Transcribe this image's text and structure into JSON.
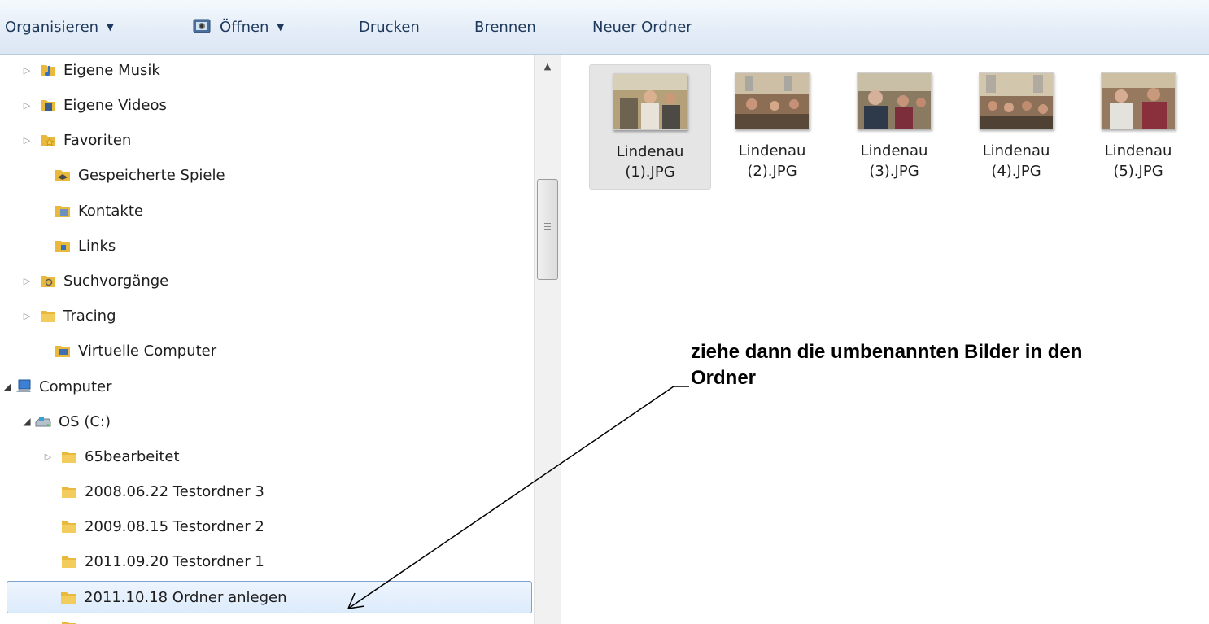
{
  "toolbar": {
    "organize": "Organisieren",
    "open": "Öffnen",
    "print": "Drucken",
    "burn": "Brennen",
    "new_folder": "Neuer Ordner"
  },
  "nav": {
    "items": [
      {
        "label": "Eigene Musik",
        "icon": "music-folder-icon",
        "expander": "collapsed"
      },
      {
        "label": "Eigene Videos",
        "icon": "video-folder-icon",
        "expander": "collapsed"
      },
      {
        "label": "Favoriten",
        "icon": "favorites-folder-icon",
        "expander": "collapsed"
      },
      {
        "label": "Gespeicherte Spiele",
        "icon": "saved-games-folder-icon",
        "expander": "none"
      },
      {
        "label": "Kontakte",
        "icon": "contacts-folder-icon",
        "expander": "none"
      },
      {
        "label": "Links",
        "icon": "links-folder-icon",
        "expander": "none"
      },
      {
        "label": "Suchvorgänge",
        "icon": "searches-folder-icon",
        "expander": "collapsed"
      },
      {
        "label": "Tracing",
        "icon": "folder-icon",
        "expander": "collapsed"
      },
      {
        "label": "Virtuelle Computer",
        "icon": "virtual-machines-folder-icon",
        "expander": "none"
      },
      {
        "label": "Computer",
        "icon": "computer-icon",
        "expander": "expanded"
      },
      {
        "label": "OS (C:)",
        "icon": "drive-icon",
        "expander": "expanded"
      },
      {
        "label": "65bearbeitet",
        "icon": "folder-icon",
        "expander": "collapsed"
      },
      {
        "label": "2008.06.22 Testordner 3",
        "icon": "folder-icon",
        "expander": "none"
      },
      {
        "label": "2009.08.15 Testordner 2",
        "icon": "folder-icon",
        "expander": "none"
      },
      {
        "label": "2011.09.20 Testordner 1",
        "icon": "folder-icon",
        "expander": "none"
      },
      {
        "label": "2011.10.18 Ordner anlegen",
        "icon": "folder-icon",
        "expander": "none",
        "selected": true
      }
    ]
  },
  "files": [
    {
      "name_line1": "Lindenau",
      "name_line2": "(1).JPG",
      "selected": true
    },
    {
      "name_line1": "Lindenau",
      "name_line2": "(2).JPG"
    },
    {
      "name_line1": "Lindenau",
      "name_line2": "(3).JPG"
    },
    {
      "name_line1": "Lindenau",
      "name_line2": "(4).JPG"
    },
    {
      "name_line1": "Lindenau",
      "name_line2": "(5).JPG"
    }
  ],
  "annotation": {
    "line1": "ziehe dann die umbenannten Bilder in den",
    "line2": "Ordner"
  },
  "colors": {
    "toolbar_text": "#1e395b",
    "selection_border": "#7da2ce",
    "folder_yellow": "#e8b93c"
  }
}
